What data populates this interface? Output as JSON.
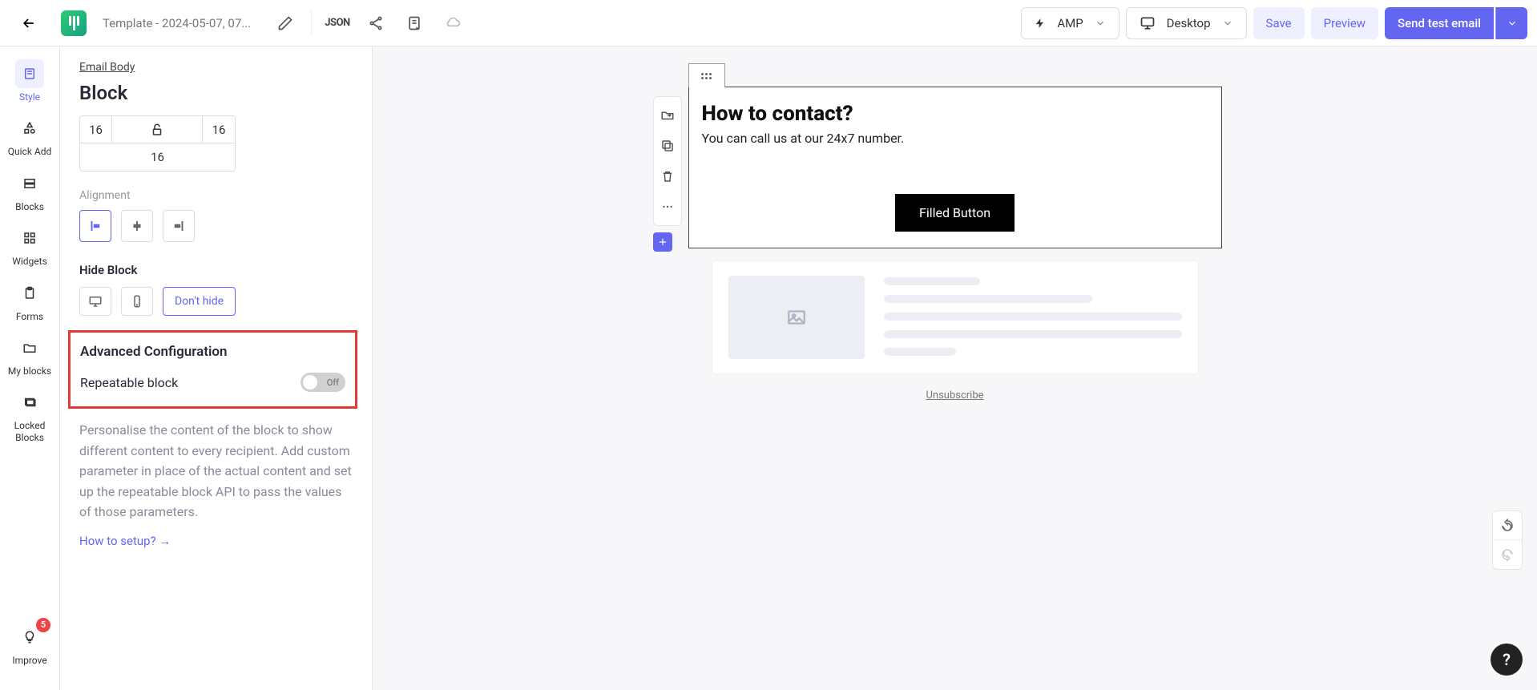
{
  "header": {
    "template_name": "Template - 2024-05-07, 07...",
    "json_label": "JSON",
    "amp_label": "AMP",
    "device_label": "Desktop",
    "save_label": "Save",
    "preview_label": "Preview",
    "send_label": "Send test email"
  },
  "leftnav": {
    "style": "Style",
    "quick_add": "Quick Add",
    "blocks": "Blocks",
    "widgets": "Widgets",
    "forms": "Forms",
    "my_blocks": "My blocks",
    "locked_blocks": "Locked Blocks",
    "improve": "Improve",
    "improve_count": "5"
  },
  "sidebar": {
    "breadcrumb": "Email Body",
    "title": "Block",
    "padding": {
      "left": "16",
      "right": "16",
      "bottom": "16"
    },
    "alignment_label": "Alignment",
    "hide_block_label": "Hide Block",
    "dont_hide_label": "Don't hide",
    "advanced_title": "Advanced Configuration",
    "repeatable_label": "Repeatable block",
    "toggle_state": "Off",
    "description": "Personalise the content of the block to show different content to every recipient. Add custom parameter in place of the actual content and set up the repeatable block API to pass the values of those parameters.",
    "setup_link": "How to setup? →"
  },
  "canvas": {
    "heading": "How to contact?",
    "paragraph": "You can call us at our 24x7 number.",
    "button_label": "Filled Button",
    "unsubscribe": "Unsubscribe"
  }
}
